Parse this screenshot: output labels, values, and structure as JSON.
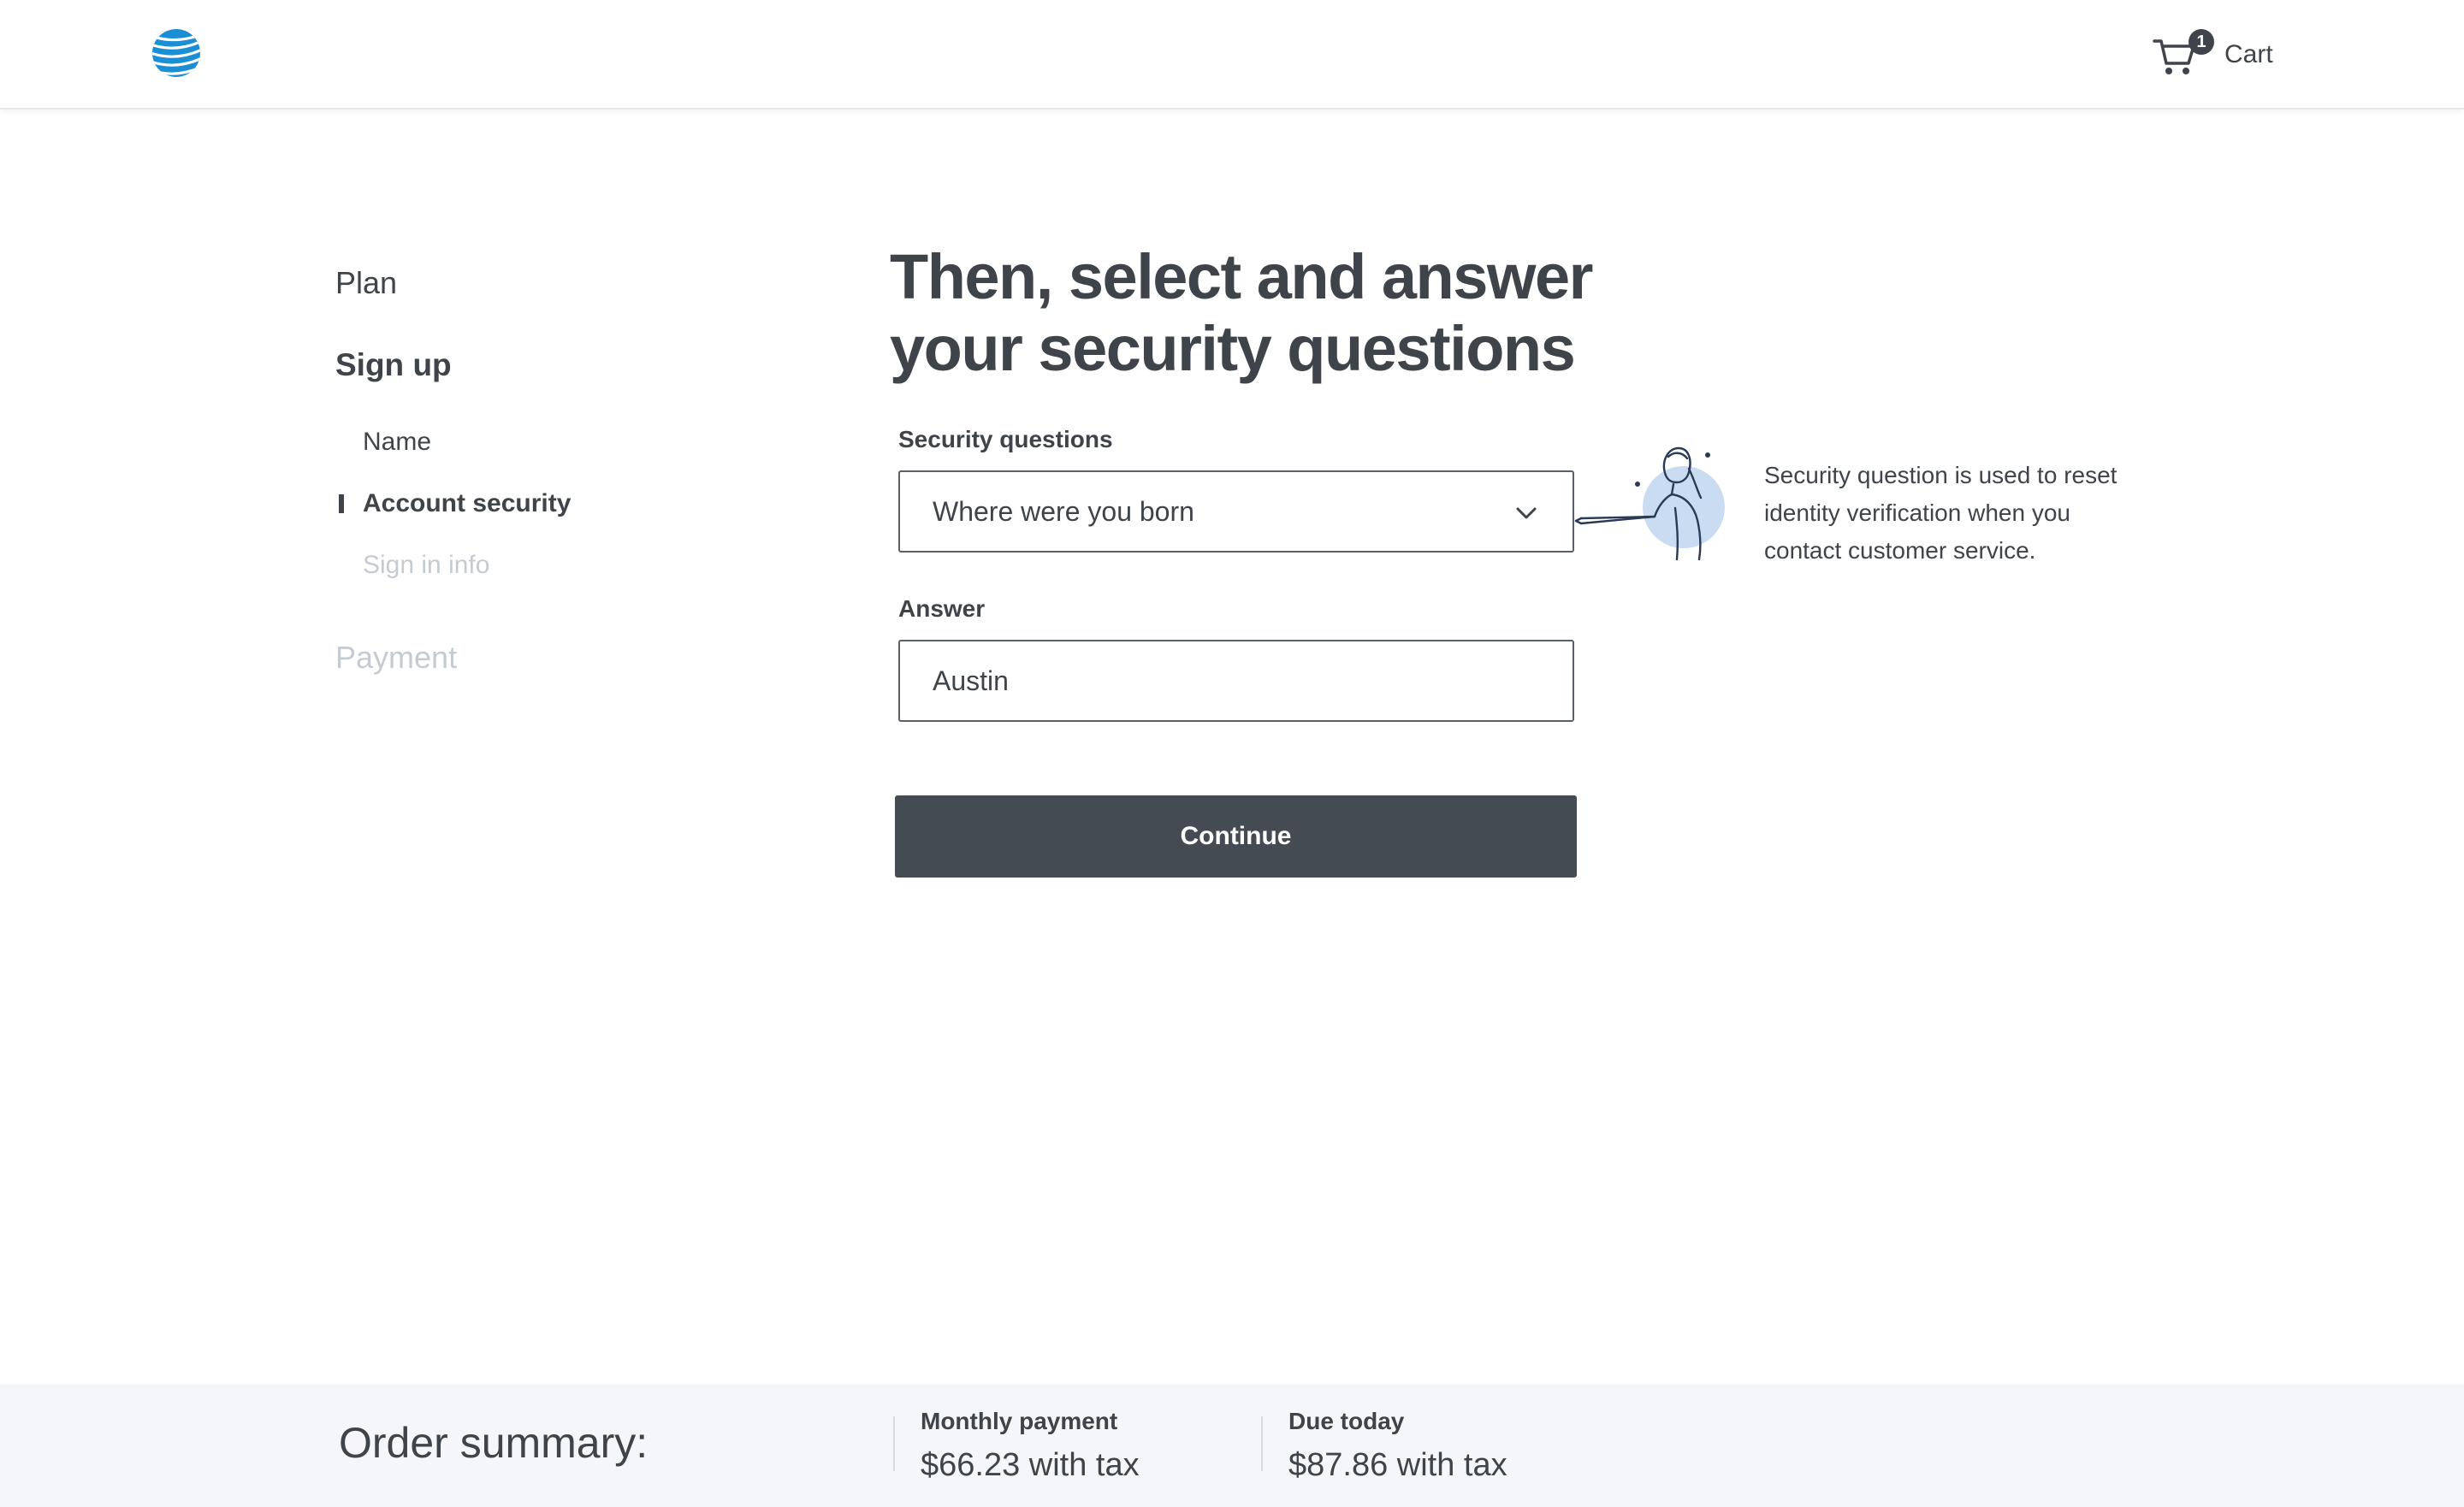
{
  "header": {
    "cart_label": "Cart",
    "cart_count": "1"
  },
  "sidebar": {
    "plan": "Plan",
    "sign_up": "Sign up",
    "sub_steps": {
      "name": "Name",
      "account_security": "Account security",
      "sign_in_info": "Sign in info"
    },
    "payment": "Payment"
  },
  "main": {
    "title": "Then, select and answer your security questions",
    "security_questions_label": "Security questions",
    "security_question_selected": "Where were you born",
    "answer_label": "Answer",
    "answer_value": "Austin",
    "continue_label": "Continue",
    "help_text": "Security question is used to reset identity verification when you contact customer service."
  },
  "footer": {
    "title": "Order summary:",
    "monthly_label": "Monthly payment",
    "monthly_value": "$66.23 with tax",
    "due_label": "Due today",
    "due_value": "$87.86 with tax"
  },
  "colors": {
    "brand_blue": "#1a8fd6",
    "button_dark": "#454b52",
    "text": "#3f444b",
    "disabled": "#c5cbd2",
    "footer_bg": "#f4f6f9"
  },
  "icons": [
    "att-logo-icon",
    "cart-icon",
    "chevron-down-icon",
    "person-pointing-illustration"
  ]
}
